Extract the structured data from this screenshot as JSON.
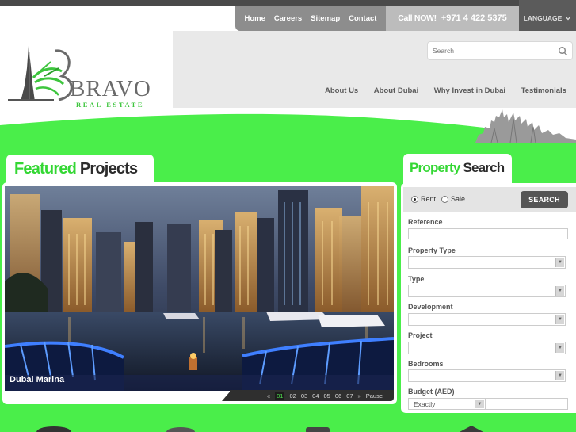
{
  "top_nav": {
    "links": [
      "Home",
      "Careers",
      "Sitemap",
      "Contact"
    ],
    "call_label": "Call NOW!",
    "call_number": "+971 4 422 5375",
    "language_label": "LANGUAGE"
  },
  "logo": {
    "name": "BRAVO",
    "tagline": "REAL ESTATE"
  },
  "search": {
    "placeholder": "Search"
  },
  "main_nav": {
    "links": [
      "About Us",
      "About Dubai",
      "Why Invest in Dubai",
      "Testimonials"
    ]
  },
  "featured": {
    "title_highlight": "Featured",
    "title_rest": "Projects",
    "caption": "Dubai Marina",
    "pager": {
      "prev": "«",
      "pages": [
        "01",
        "02",
        "03",
        "04",
        "05",
        "06",
        "07"
      ],
      "active_page": "01",
      "next": "»",
      "pause": "Pause"
    }
  },
  "property_search": {
    "title_highlight": "Property",
    "title_rest": "Search",
    "radio_rent": "Rent",
    "radio_sale": "Sale",
    "selected": "Rent",
    "button": "SEARCH",
    "fields": {
      "reference": "Reference",
      "property_type": "Property Type",
      "type": "Type",
      "development": "Development",
      "project": "Project",
      "bedrooms": "Bedrooms",
      "budget": "Budget (AED)"
    },
    "budget_mode": "Exactly"
  },
  "colors": {
    "brand_green": "#34d734",
    "band_green": "#4aee4a",
    "dark_gray": "#2c2c2c"
  }
}
